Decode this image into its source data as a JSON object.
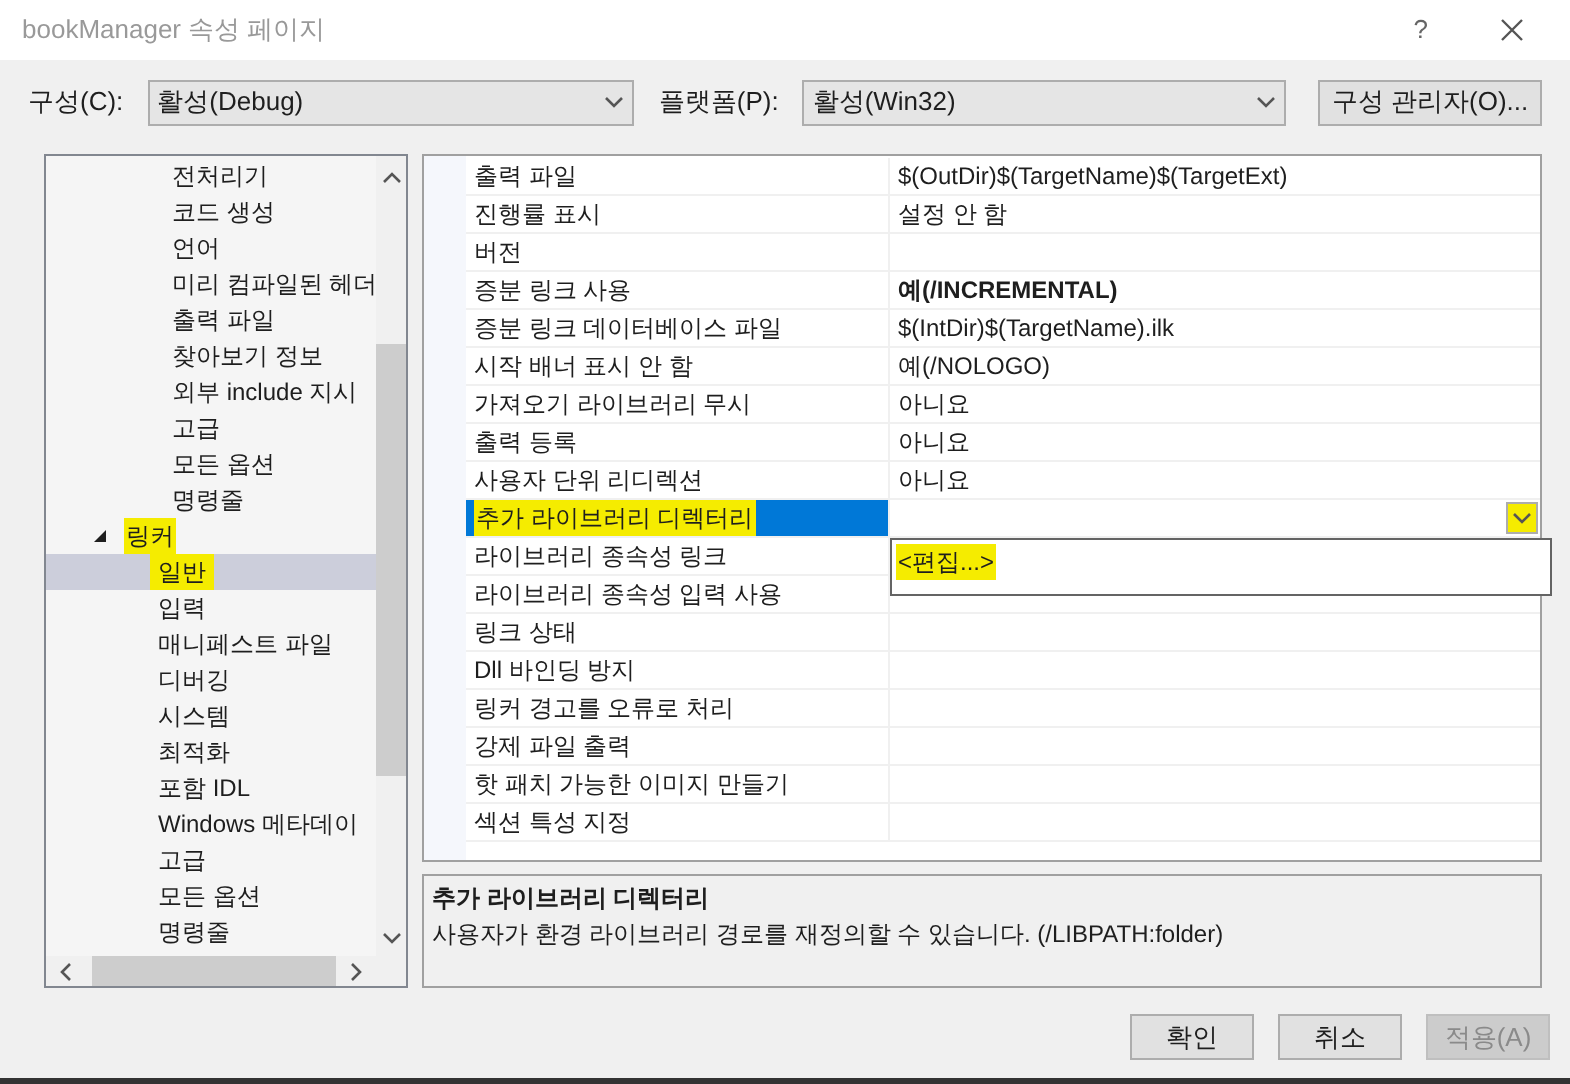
{
  "window": {
    "title": "bookManager 속성 페이지",
    "help": "?"
  },
  "config_bar": {
    "configuration_label": "구성(C):",
    "configuration_value": "활성(Debug)",
    "platform_label": "플랫폼(P):",
    "platform_value": "활성(Win32)",
    "manager_button": "구성 관리자(O)..."
  },
  "tree": {
    "items_above": [
      {
        "label": "전처리기",
        "selected": false
      },
      {
        "label": "코드 생성",
        "selected": false
      },
      {
        "label": "언어",
        "selected": false
      },
      {
        "label": "미리 컴파일된 헤더",
        "selected": false
      },
      {
        "label": "출력 파일",
        "selected": false
      },
      {
        "label": "찾아보기 정보",
        "selected": false
      },
      {
        "label": "외부 include 지시",
        "selected": false
      },
      {
        "label": "고급",
        "selected": false
      },
      {
        "label": "모든 옵션",
        "selected": false
      },
      {
        "label": "명령줄",
        "selected": false
      }
    ],
    "items": [
      {
        "label": "링커",
        "expanded": true,
        "selected": false,
        "highlighted": true,
        "children": [
          {
            "label": "일반",
            "selected": true,
            "highlighted": true
          },
          {
            "label": "입력",
            "selected": false,
            "highlighted": false
          },
          {
            "label": "매니페스트 파일",
            "selected": false,
            "highlighted": false
          },
          {
            "label": "디버깅",
            "selected": false,
            "highlighted": false
          },
          {
            "label": "시스템",
            "selected": false,
            "highlighted": false
          },
          {
            "label": "최적화",
            "selected": false,
            "highlighted": false
          },
          {
            "label": "포함 IDL",
            "selected": false,
            "highlighted": false
          },
          {
            "label": "Windows 메타데이",
            "selected": false,
            "highlighted": false
          },
          {
            "label": "고급",
            "selected": false,
            "highlighted": false
          },
          {
            "label": "모든 옵션",
            "selected": false,
            "highlighted": false
          },
          {
            "label": "명령줄",
            "selected": false,
            "highlighted": false
          }
        ]
      }
    ]
  },
  "properties": [
    {
      "name": "출력 파일",
      "value": "$(OutDir)$(TargetName)$(TargetExt)",
      "selected": false
    },
    {
      "name": "진행률 표시",
      "value": "설정 안 함",
      "selected": false
    },
    {
      "name": "버전",
      "selected": false
    },
    {
      "name": "증분 링크 사용",
      "value": "예(/INCREMENTAL)",
      "bold": true,
      "selected": false
    },
    {
      "name": "증분 링크 데이터베이스 파일",
      "value": "$(IntDir)$(TargetName).ilk",
      "selected": false
    },
    {
      "name": "시작 배너 표시 안 함",
      "value": "예(/NOLOGO)",
      "selected": false
    },
    {
      "name": "가져오기 라이브러리 무시",
      "value": "아니요",
      "selected": false
    },
    {
      "name": "출력 등록",
      "value": "아니요",
      "selected": false
    },
    {
      "name": "사용자 단위 리디렉션",
      "value": "아니요",
      "selected": false
    },
    {
      "name": "추가 라이브러리 디렉터리",
      "selected": true
    },
    {
      "name": "라이브러리 종속성 링크",
      "selected": false
    },
    {
      "name": "라이브러리 종속성 입력 사용",
      "selected": false
    },
    {
      "name": "링크 상태",
      "selected": false
    },
    {
      "name": "Dll 바인딩 방지",
      "selected": false
    },
    {
      "name": "링커 경고를 오류로 처리",
      "selected": false
    },
    {
      "name": "강제 파일 출력",
      "selected": false
    },
    {
      "name": "핫 패치 가능한 이미지 만들기",
      "selected": false
    },
    {
      "name": "섹션 특성 지정",
      "selected": false
    }
  ],
  "dropdown": {
    "options": [
      {
        "label": "<편집...>",
        "highlighted": true
      }
    ]
  },
  "description": {
    "title": "추가 라이브러리 디렉터리",
    "text": "사용자가 환경 라이브러리 경로를 재정의할 수 있습니다. (/LIBPATH:folder)"
  },
  "buttons": [
    {
      "label": "확인",
      "disabled": false
    },
    {
      "label": "취소",
      "disabled": false
    },
    {
      "label": "적용(A)",
      "disabled": true
    }
  ]
}
